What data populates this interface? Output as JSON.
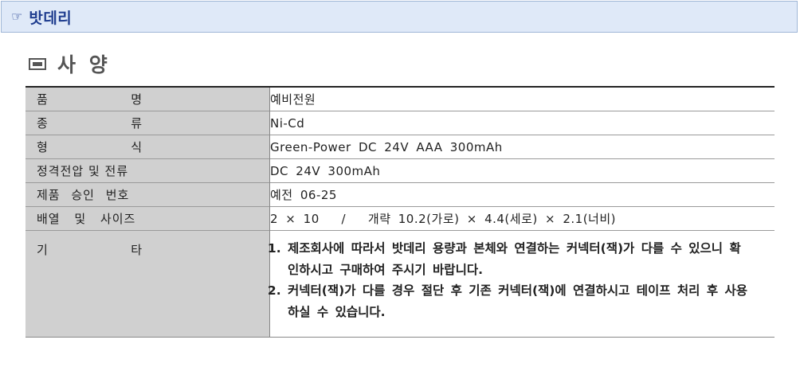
{
  "header": {
    "icon": "hand-pointing-icon",
    "title": "밧데리"
  },
  "section": {
    "icon": "square-icon",
    "title": "사 양"
  },
  "spec": {
    "rows": [
      {
        "label_left": "품",
        "label_right": "명",
        "value": "예비전원"
      },
      {
        "label_left": "종",
        "label_right": "류",
        "value": "Ni-Cd"
      },
      {
        "label_left": "형",
        "label_right": "식",
        "value": "Green-Power DC 24V AAA 300mAh"
      },
      {
        "label": "정격전압 및 전류",
        "value": "DC 24V 300mAh"
      },
      {
        "label": "제품 승인 번호",
        "value": "예전 06-25"
      },
      {
        "label": "배열 및 사이즈",
        "value": "2 × 10   /   개략 10.2(가로) × 4.4(세로) × 2.1(너비)"
      }
    ],
    "notes_row": {
      "label_left": "기",
      "label_right": "타",
      "items": [
        "제조회사에 따라서 밧데리 용량과 본체와 연결하는 커넥터(잭)가 다를 수 있으니 확인하시고 구매하여 주시기 바랍니다.",
        "커넥터(잭)가 다를 경우 절단 후 기존 커넥터(잭)에 연결하시고 테이프 처리 후 사용하실 수 있습니다."
      ]
    }
  }
}
